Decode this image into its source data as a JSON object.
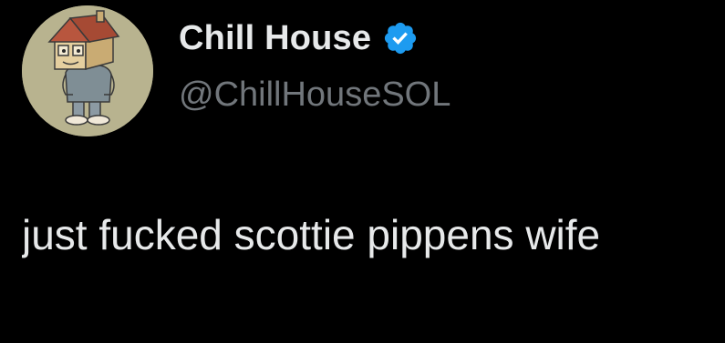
{
  "author": {
    "display_name": "Chill House",
    "handle": "@ChillHouseSOL",
    "verified_icon": "verified-badge-icon",
    "badge_color": "#1d9bf0",
    "avatar_icon": "house-head-character-avatar"
  },
  "tweet": {
    "text": "just fucked scottie pippens wife"
  },
  "colors": {
    "background": "#000000",
    "primary_text": "#e7e9ea",
    "secondary_text": "#71767b"
  }
}
